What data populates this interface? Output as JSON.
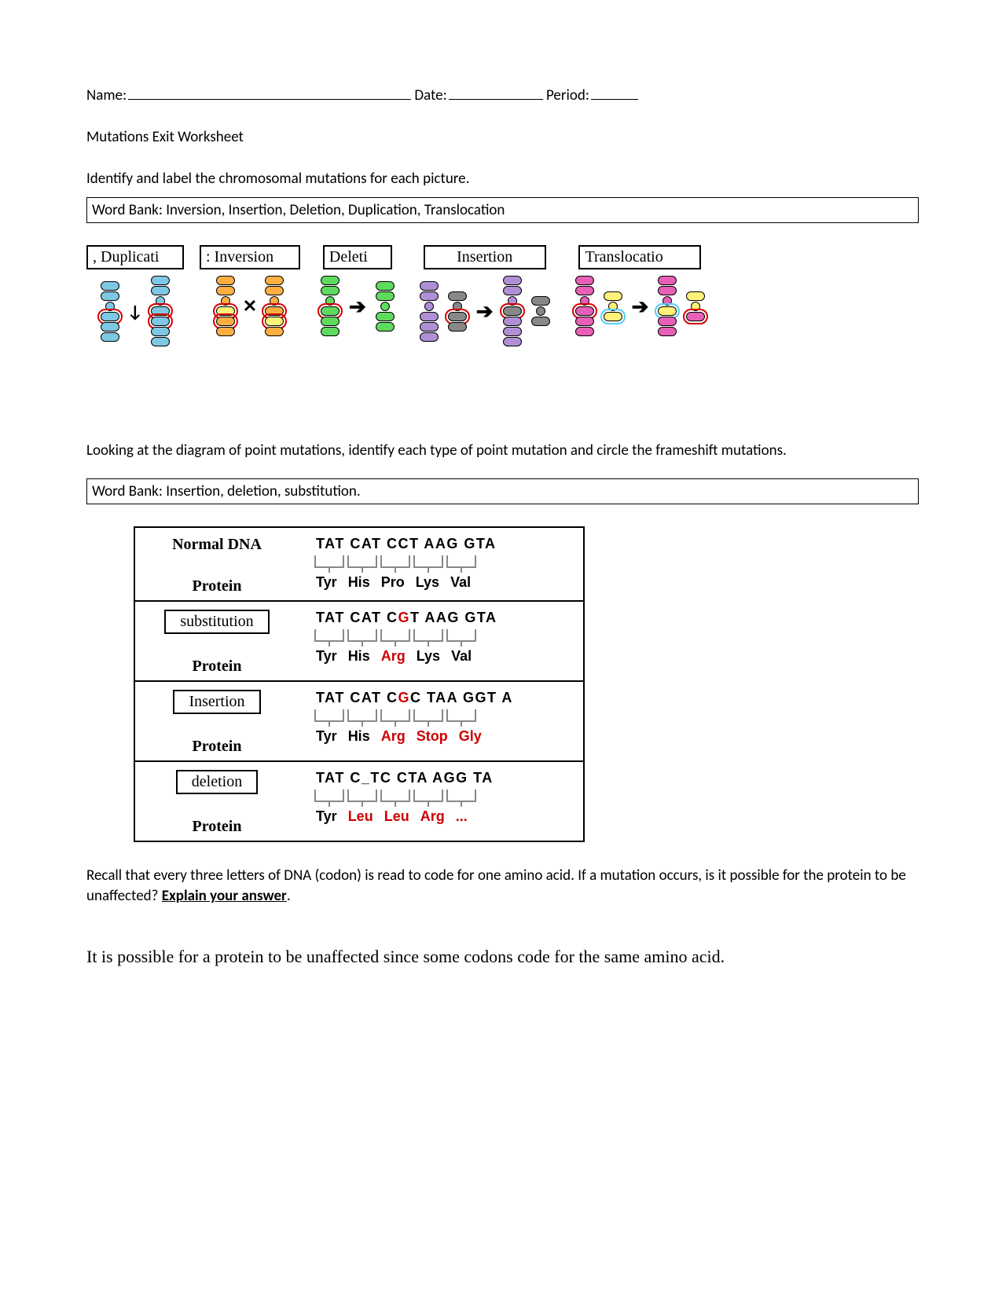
{
  "header": {
    "name_label": "Name:",
    "date_label": "Date:",
    "period_label": "Period:"
  },
  "doc_title": "Mutations Exit Worksheet",
  "chrom_instr": "Identify and label the chromosomal mutations for each picture.",
  "wordbank1": "Word Bank: Inversion, Insertion, Deletion, Duplication, Translocation",
  "chrom_answers": {
    "a": ", Duplicati",
    "b": ": Inversion",
    "c": "Deleti",
    "d": "Insertion",
    "e": "Translocatio"
  },
  "pm_instr": "Looking at the diagram of point mutations, identify each type of point mutation and circle the frameshift mutations.",
  "wordbank2": "Word Bank: Insertion, deletion, substitution.",
  "pm_labels": {
    "normal_dna": "Normal DNA",
    "protein": "Protein",
    "sub_ans": "substitution",
    "ins_ans": "Insertion",
    "del_ans": "deletion"
  },
  "pm_rows": {
    "normal": {
      "dna": [
        "TAT",
        "CAT",
        "CCT",
        "AAG",
        "GTA"
      ],
      "aa": [
        "Tyr",
        "His",
        "Pro",
        "Lys",
        "Val"
      ]
    },
    "sub": {
      "dna_pre": "TAT CAT C",
      "dna_mut": "G",
      "dna_post": "T AAG GTA",
      "aa": [
        "Tyr",
        "His",
        "Arg",
        "Lys",
        "Val"
      ],
      "aa_red": [
        2
      ]
    },
    "ins": {
      "dna_pre": "TAT CAT C",
      "dna_mut": "G",
      "dna_post": "C TAA GGT A",
      "aa": [
        "Tyr",
        "His",
        "Arg",
        "Stop",
        "Gly"
      ],
      "aa_red": [
        2,
        3,
        4
      ]
    },
    "del": {
      "dna": "TAT C_TC CTA AGG TA",
      "aa": [
        "Tyr",
        "Leu",
        "Leu",
        "Arg",
        "..."
      ],
      "aa_red": [
        1,
        2,
        3,
        4
      ]
    }
  },
  "final_question_pre": "Recall that every three letters of DNA (codon) is read to code for one amino acid. If a mutation occurs, is it possible for the protein to be unaffected? ",
  "final_question_emph": "Explain your answer",
  "final_question_post": ".",
  "final_answer": "It is possible for a protein to be unaffected since some codons code for the same amino acid."
}
